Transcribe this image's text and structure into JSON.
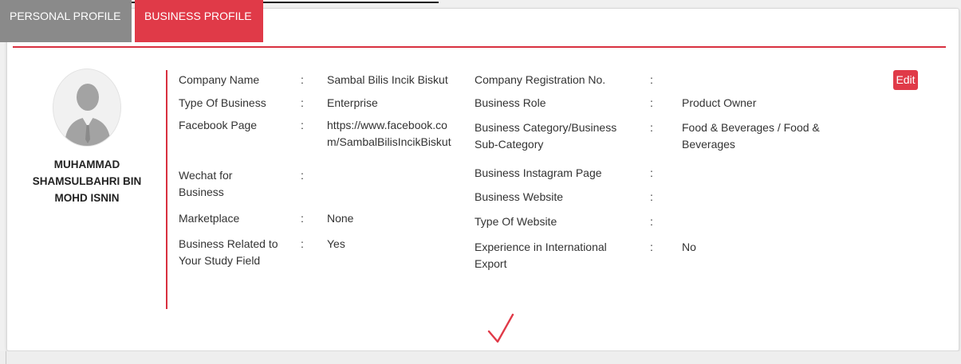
{
  "tabs": [
    {
      "label": "PERSONAL PROFILE"
    },
    {
      "label": "BUSINESS PROFILE"
    }
  ],
  "user": {
    "name_lines": [
      "MUHAMMAD",
      "SHAMSULBAHRI BIN",
      "MOHD ISNIN"
    ]
  },
  "separator": ":",
  "left_fields": [
    {
      "label": "Company Name",
      "value": "Sambal Bilis Incik Biskut"
    },
    {
      "label": "Type Of Business",
      "value": "Enterprise"
    },
    {
      "label": "Facebook Page",
      "value_lines": [
        "https://www.facebook.co",
        "m/SambalBilisIncikBiskut"
      ]
    },
    {
      "label_lines": [
        "Wechat for",
        "Business"
      ],
      "value": ""
    },
    {
      "label": "Marketplace",
      "value": "None"
    },
    {
      "label_lines": [
        "Business Related to",
        "Your Study Field"
      ],
      "value": "Yes"
    }
  ],
  "right_fields": [
    {
      "label": "Company Registration No.",
      "value": ""
    },
    {
      "label": "Business Role",
      "value": "Product Owner"
    },
    {
      "label_lines": [
        "Business Category/Business",
        "Sub-Category"
      ],
      "value_lines": [
        "Food & Beverages / Food &",
        "Beverages"
      ]
    },
    {
      "label": "Business Instagram Page",
      "value": ""
    },
    {
      "label": "Business Website",
      "value": ""
    },
    {
      "label": "Type Of Website",
      "value": ""
    },
    {
      "label_lines": [
        "Experience in International",
        "Export"
      ],
      "value": "No"
    }
  ],
  "edit_label": "Edit",
  "colors": {
    "accent": "#e03a48",
    "tab_inactive": "#8a8a8a"
  },
  "icons": {
    "avatar": "user-silhouette-icon",
    "status": "checkmark-icon"
  }
}
